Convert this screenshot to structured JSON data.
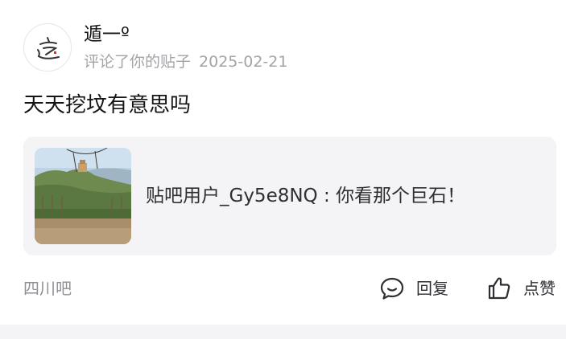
{
  "post": {
    "username": "遁一º",
    "action_text": "评论了你的贴子",
    "date": "2025-02-21",
    "content": "天天挖坟有意思吗",
    "quote": {
      "text": "贴吧用户_Gy5e8NQ : 你看那个巨石！",
      "thumbnail_icon": "landscape-photo"
    },
    "forum": "四川吧",
    "actions": {
      "reply_label": "回复",
      "like_label": "点赞"
    }
  },
  "colors": {
    "primary_text": "#141414",
    "secondary_text": "#a3a3a8",
    "quote_background": "#f4f4f6",
    "icon": "#2e2e33"
  }
}
